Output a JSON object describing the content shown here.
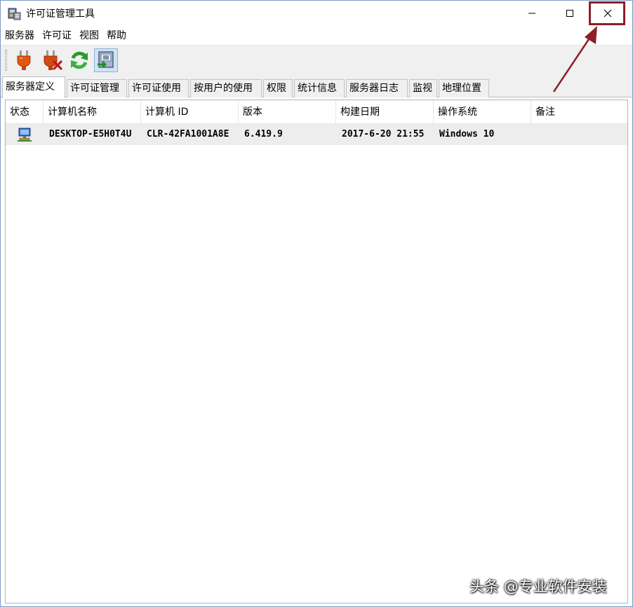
{
  "window": {
    "title": "许可证管理工具"
  },
  "menu": [
    "服务器",
    "许可证",
    "视图",
    "帮助"
  ],
  "tabs": [
    {
      "label": "服务器定义",
      "active": true
    },
    {
      "label": "许可证管理",
      "active": false
    },
    {
      "label": "许可证使用",
      "active": false
    },
    {
      "label": "按用户的使用",
      "active": false
    },
    {
      "label": "权限",
      "active": false
    },
    {
      "label": "统计信息",
      "active": false
    },
    {
      "label": "服务器日志",
      "active": false
    },
    {
      "label": "监视",
      "active": false
    },
    {
      "label": "地理位置",
      "active": false
    }
  ],
  "toolbar": {
    "icons": [
      "plug-connect-icon",
      "plug-disconnect-icon",
      "refresh-icon",
      "export-icon"
    ]
  },
  "table": {
    "columns": [
      "状态",
      "计算机名称",
      "计算机 ID",
      "版本",
      "构建日期",
      "操作系统",
      "备注"
    ],
    "rows": [
      {
        "status_icon": "computer-icon",
        "computer_name": "DESKTOP-E5H0T4U",
        "computer_id": "CLR-42FA1001A8E",
        "version": "6.419.9",
        "build_date": "2017-6-20 21:55",
        "os": "Windows 10",
        "note": ""
      }
    ]
  },
  "watermark": "头条 @专业软件安装",
  "colors": {
    "annotation": "#8b1f2a",
    "selected_row": "#ededed",
    "toolbar_bg": "#f0f0f0"
  }
}
